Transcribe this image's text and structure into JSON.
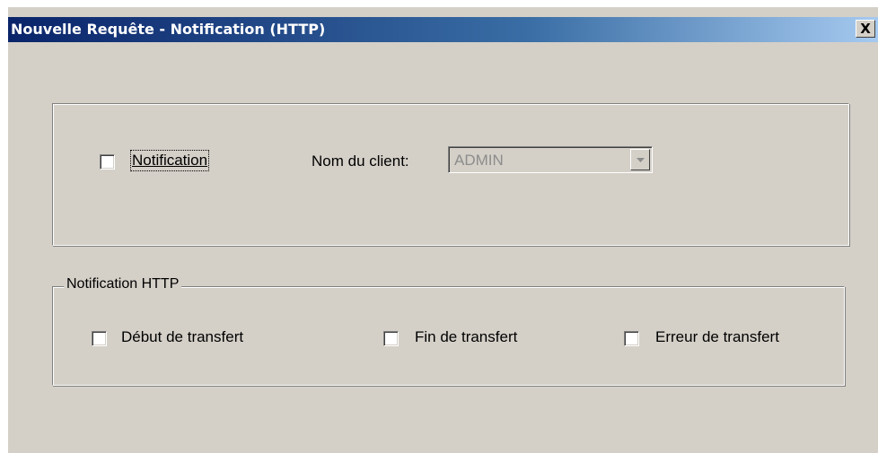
{
  "window": {
    "title": "Nouvelle Requête - Notification (HTTP)",
    "close_label": "X"
  },
  "notification": {
    "checkbox_label": "Notification",
    "checked": false,
    "client_label": "Nom du client:",
    "client_value": "ADMIN",
    "client_enabled": false
  },
  "http_group": {
    "legend": "Notification HTTP",
    "options": [
      {
        "label": "Début de transfert",
        "checked": false
      },
      {
        "label": "Fin de transfert",
        "checked": false
      },
      {
        "label": "Erreur de transfert",
        "checked": false
      }
    ]
  },
  "colors": {
    "titlebar_start": "#0a246a",
    "titlebar_end": "#a6caf0",
    "dialog_bg": "#d4d0c8",
    "disabled_text": "#8c8c8c"
  }
}
